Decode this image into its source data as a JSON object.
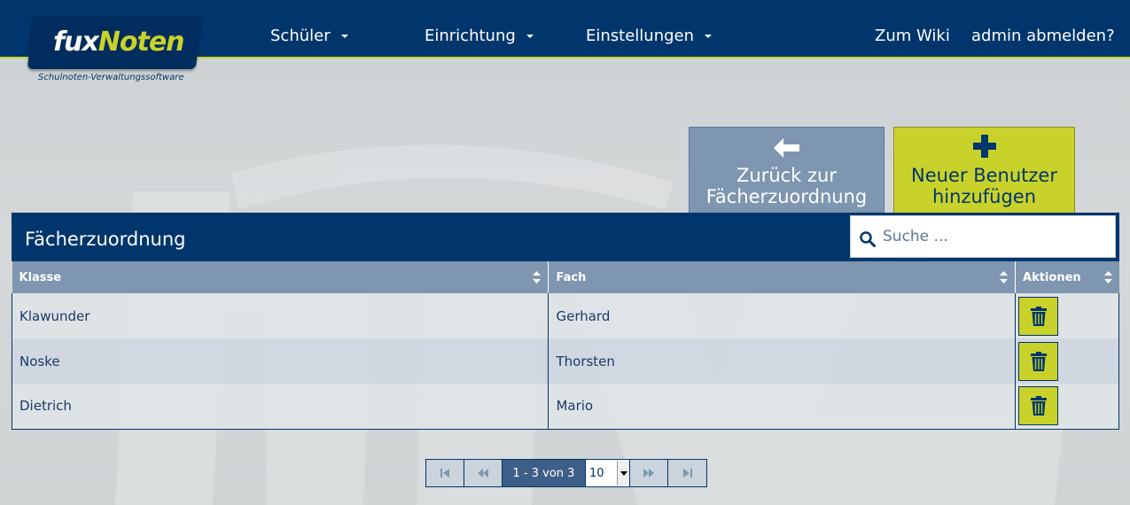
{
  "brand": {
    "logo_part1": "fux",
    "logo_part2": "Noten",
    "tagline": "Schulnoten-Verwaltungssoftware"
  },
  "nav": {
    "items": [
      {
        "label": "Schüler"
      },
      {
        "label": "Einrichtung"
      },
      {
        "label": "Einstellungen"
      }
    ],
    "wiki": "Zum Wiki",
    "logout": "admin abmelden?"
  },
  "actions": {
    "back_line1": "Zurück zur",
    "back_line2": "Fächerzuordnung",
    "new_line1": "Neuer Benutzer",
    "new_line2": "hinzufügen"
  },
  "panel": {
    "title": "Fächerzuordnung",
    "search_placeholder": "Suche ..."
  },
  "table": {
    "headers": [
      "Klasse",
      "Fach",
      "Aktionen"
    ],
    "rows": [
      {
        "klasse": "Klawunder",
        "fach": "Gerhard"
      },
      {
        "klasse": "Noske",
        "fach": "Thorsten"
      },
      {
        "klasse": "Dietrich",
        "fach": "Mario"
      }
    ]
  },
  "pager": {
    "info": "1 - 3 von 3",
    "page_size": "10"
  },
  "colors": {
    "navy": "#00366b",
    "lime": "#c9d22a",
    "slate": "#7e96b0"
  }
}
